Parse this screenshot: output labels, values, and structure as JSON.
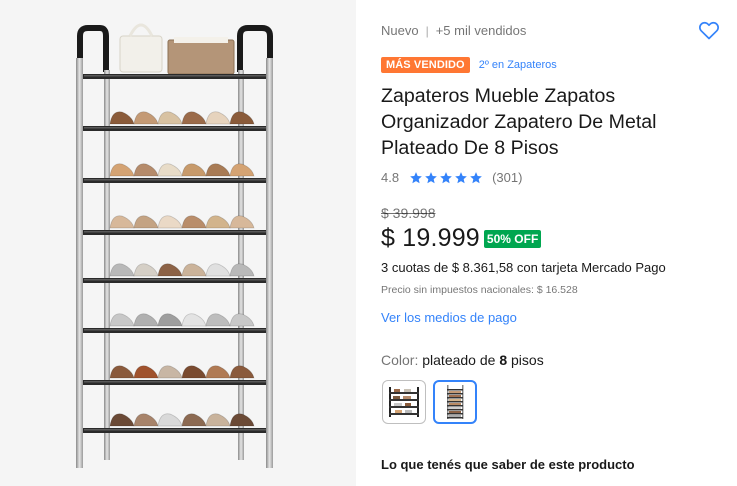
{
  "product": {
    "condition": "Nuevo",
    "sold": "+5 mil vendidos",
    "badge": "MÁS VENDIDO",
    "ranking": "2º en Zapateros",
    "title": "Zapateros Mueble Zapatos Organizador Zapatero De Metal Plateado De 8 Pisos",
    "rating": "4.8",
    "rating_value": 4.8,
    "reviews": "(301)",
    "original_price": "$ 39.998",
    "price": "$ 19.999",
    "discount": "50% OFF",
    "installments": "3 cuotas de $ 8.361,58 con tarjeta Mercado Pago",
    "tax_note": "Precio sin impuestos nacionales: $ 16.528",
    "payment_link": "Ver los medios de pago",
    "color_label": "Color:",
    "color_value_prefix": "plateado de",
    "color_value_number": "8",
    "color_value_suffix": "pisos",
    "variants": [
      "negro de 4 pisos",
      "plateado de 8 pisos"
    ],
    "selected_variant": 1,
    "know_more": "Lo que tenés que saber de este producto"
  },
  "icons": {
    "favorite": "heart-outline-icon",
    "star": "star-icon"
  },
  "colors": {
    "accent": "#3483fa",
    "badge": "#ff7733",
    "discount": "#00a650",
    "gallery_bg": "#f5f5f5"
  }
}
